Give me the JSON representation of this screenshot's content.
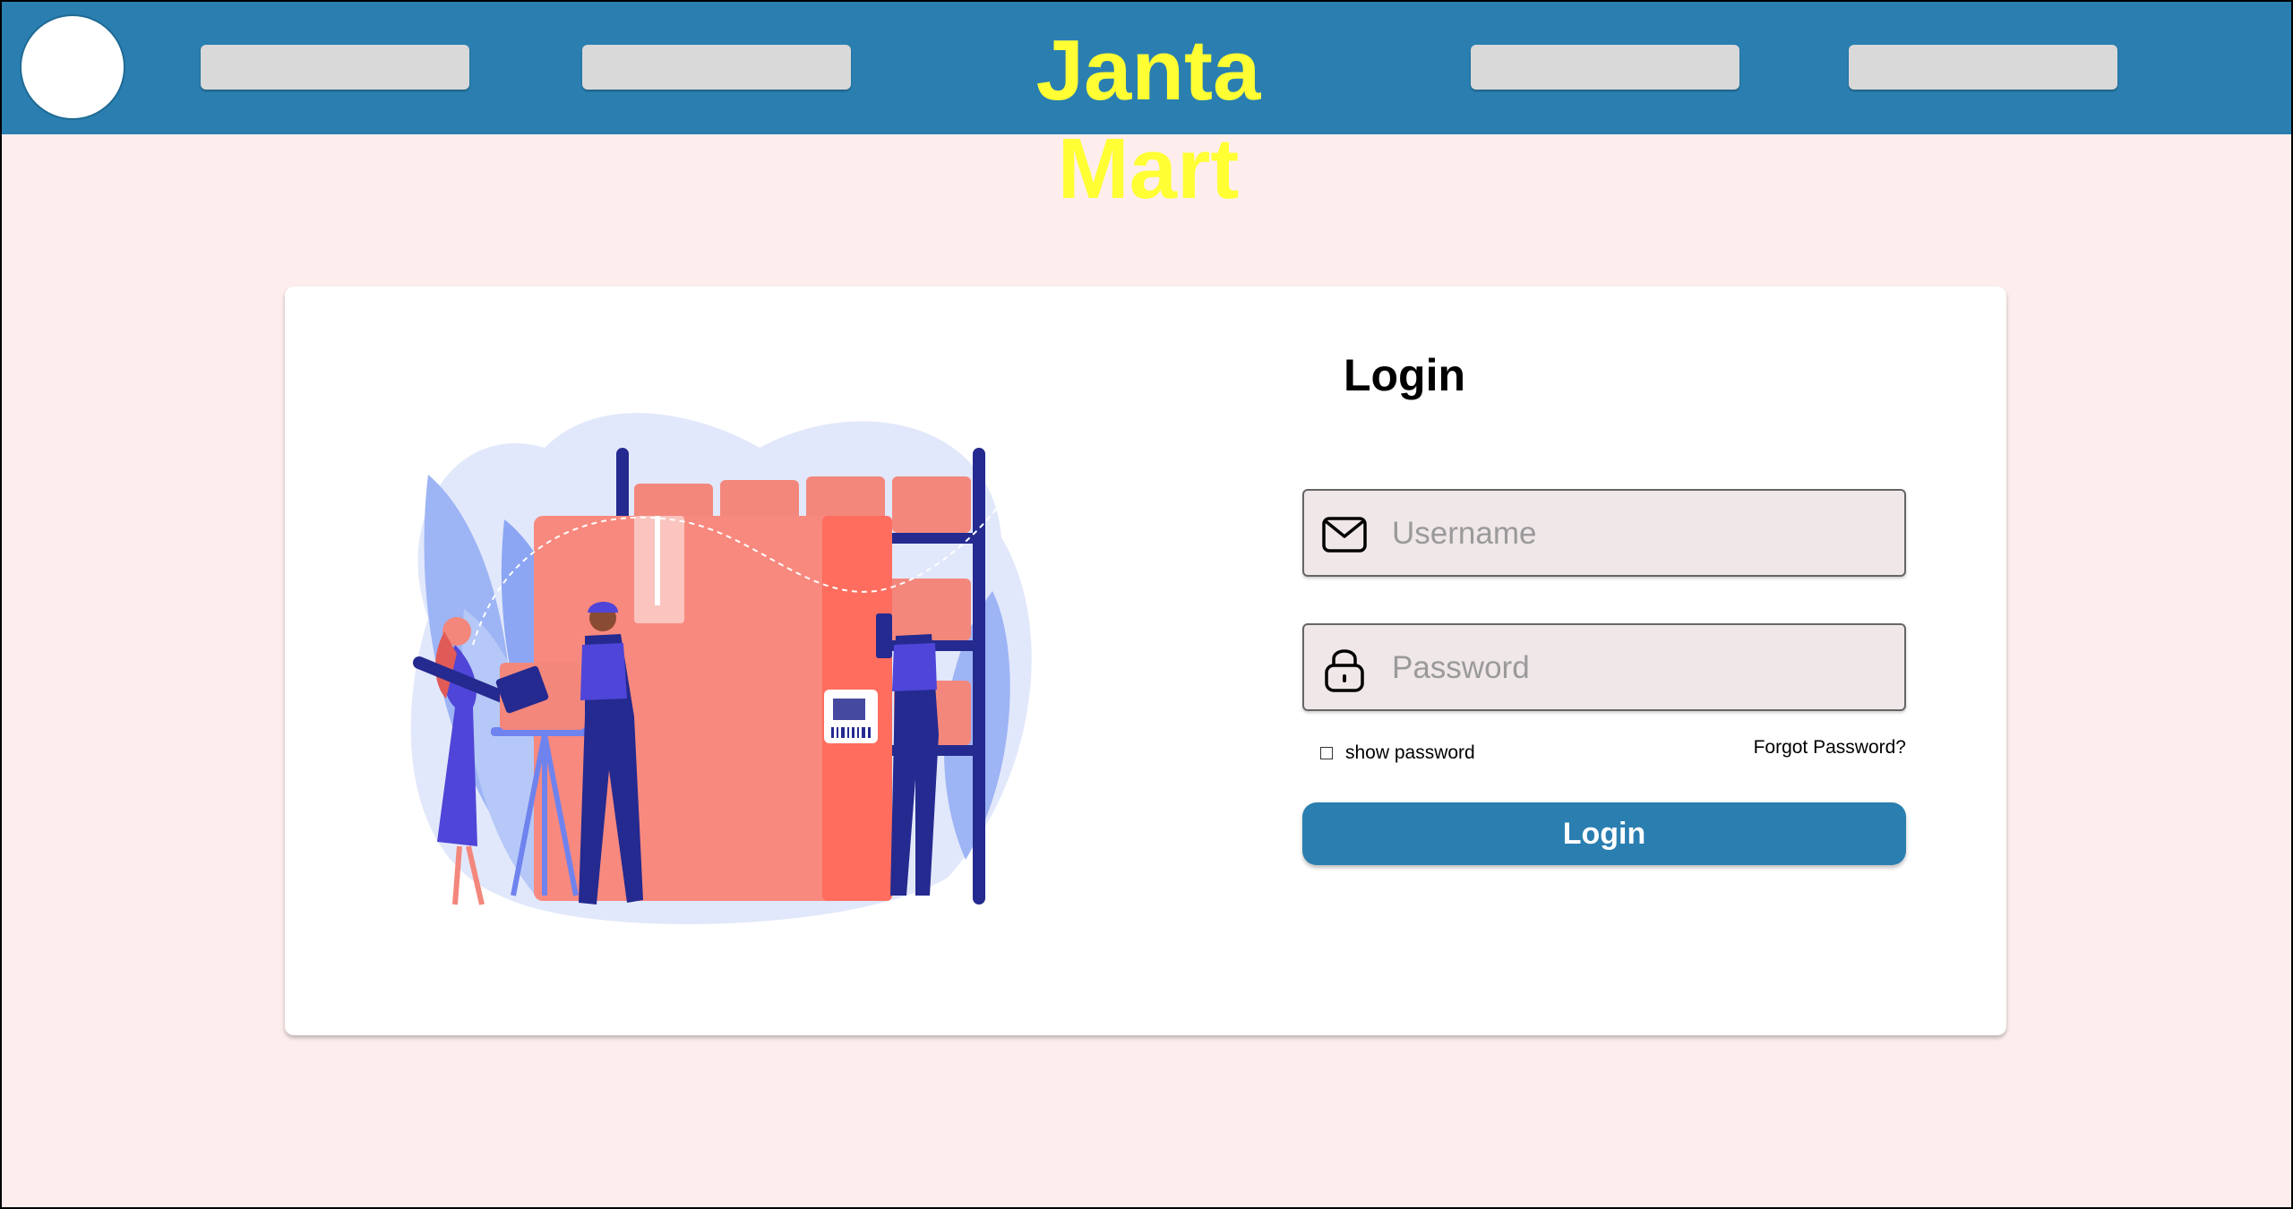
{
  "navbar": {
    "brand": "Janta Mart",
    "brand_color": "#ffff33",
    "background_color": "#2a7fb0",
    "avatar_icon": "avatar-circle",
    "placeholder_items": 4
  },
  "login": {
    "title": "Login",
    "username_placeholder": "Username",
    "username_icon": "mail-icon",
    "password_placeholder": "Password",
    "password_icon": "lock-icon",
    "show_password_label": "show password",
    "show_password_checked": false,
    "forgot_password_label": "Forgot Password?",
    "button_label": "Login",
    "accent_color": "#2a7fb0"
  },
  "illustration": {
    "subject": "warehouse-inventory-illustration"
  }
}
